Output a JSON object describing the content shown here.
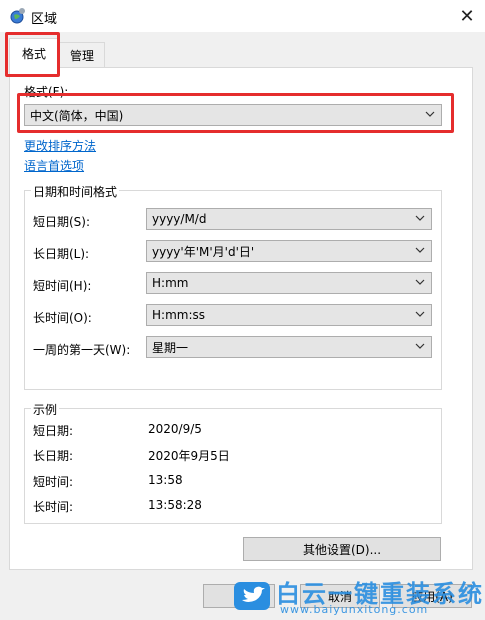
{
  "window": {
    "title": "区域"
  },
  "tabs": [
    {
      "label": "格式"
    },
    {
      "label": "管理"
    }
  ],
  "format": {
    "label": "格式(F):",
    "value": "中文(简体，中国)",
    "link_sort": "更改排序方法",
    "link_language": "语言首选项"
  },
  "datetime": {
    "title": "日期和时间格式",
    "rows": [
      {
        "label": "短日期(S):",
        "value": "yyyy/M/d"
      },
      {
        "label": "长日期(L):",
        "value": "yyyy'年'M'月'd'日'"
      },
      {
        "label": "短时间(H):",
        "value": "H:mm"
      },
      {
        "label": "长时间(O):",
        "value": "H:mm:ss"
      },
      {
        "label": "一周的第一天(W):",
        "value": "星期一"
      }
    ]
  },
  "examples": {
    "title": "示例",
    "rows": [
      {
        "label": "短日期:",
        "value": "2020/9/5"
      },
      {
        "label": "长日期:",
        "value": "2020年9月5日"
      },
      {
        "label": "短时间:",
        "value": "13:58"
      },
      {
        "label": "长时间:",
        "value": "13:58:28"
      }
    ]
  },
  "buttons": {
    "other_settings": "其他设置(D)...",
    "cancel": "取消",
    "apply": "应用(A)"
  },
  "watermark": {
    "name": "白云一键重装系统",
    "url": "www.baiyunxitong.com"
  },
  "colors": {
    "highlight": "#e52d2d",
    "link": "#0066cc",
    "watermark": "#2a8ee0"
  }
}
